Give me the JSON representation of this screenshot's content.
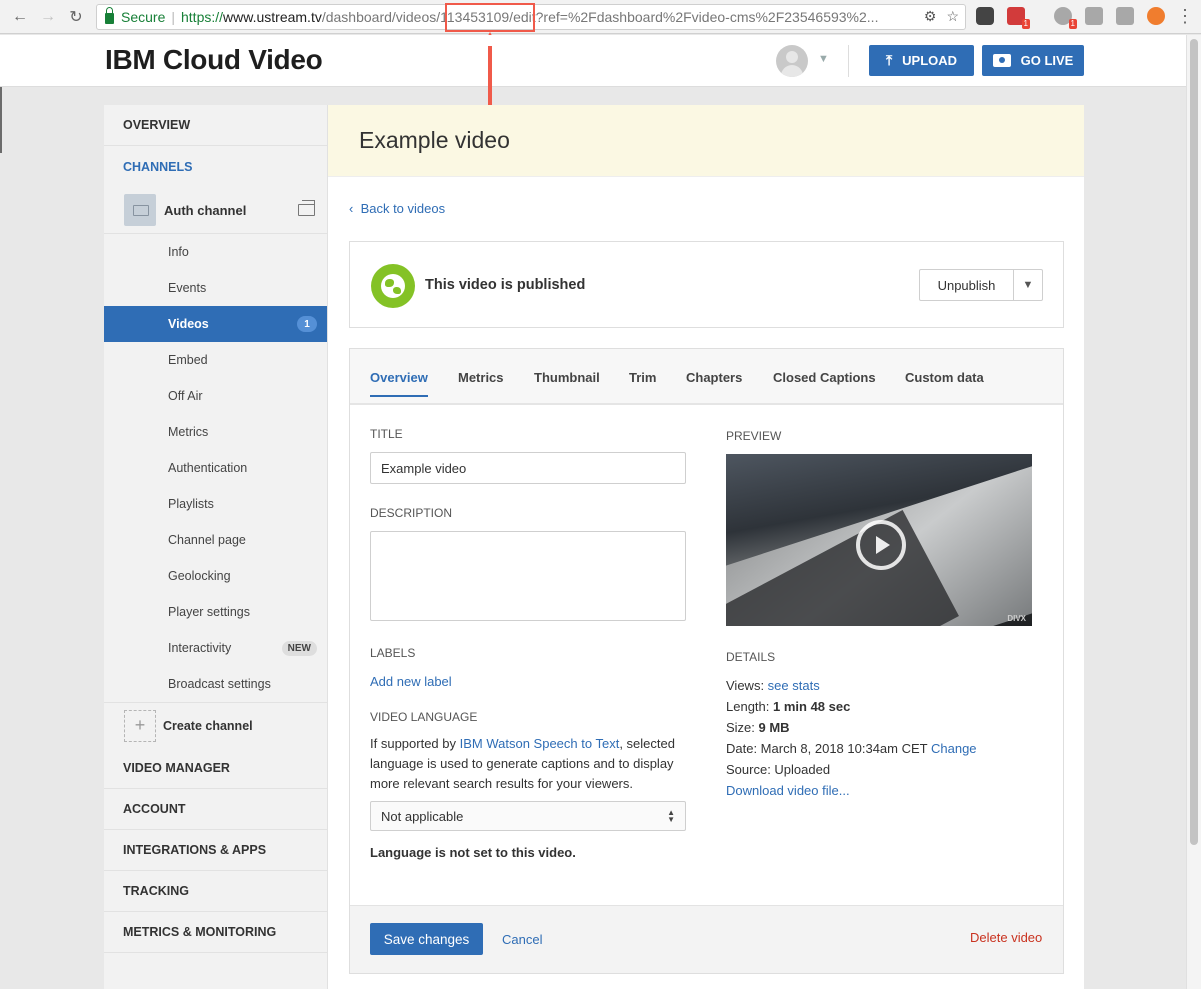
{
  "browser": {
    "secure_label": "Secure",
    "url_https": "https://",
    "url_host": "www.ustream.tv",
    "url_path": "/dashboard/videos/113453109/edit?ref=%2Fdashboard%2Fvideo-cms%2F23546593%2...",
    "badge_red": "1",
    "badge_green": "1"
  },
  "header": {
    "brand": "IBM Cloud Video",
    "upload_label": "UPLOAD",
    "golive_label": "GO LIVE"
  },
  "sidebar": {
    "overview": "OVERVIEW",
    "channels": "CHANNELS",
    "channel_name": "Auth channel",
    "sub_items": [
      {
        "label": "Info"
      },
      {
        "label": "Events"
      },
      {
        "label": "Videos",
        "count": "1"
      },
      {
        "label": "Embed"
      },
      {
        "label": "Off Air"
      },
      {
        "label": "Metrics"
      },
      {
        "label": "Authentication"
      },
      {
        "label": "Playlists"
      },
      {
        "label": "Channel page"
      },
      {
        "label": "Geolocking"
      },
      {
        "label": "Player settings"
      },
      {
        "label": "Interactivity",
        "badge": "NEW"
      },
      {
        "label": "Broadcast settings"
      }
    ],
    "create_channel": "Create channel",
    "bottom_items": [
      "VIDEO MANAGER",
      "ACCOUNT",
      "INTEGRATIONS & APPS",
      "TRACKING",
      "METRICS & MONITORING"
    ]
  },
  "main": {
    "title": "Example video",
    "back_link": "Back to videos",
    "published_text": "This video is published",
    "unpublish_label": "Unpublish",
    "tabs": [
      "Overview",
      "Metrics",
      "Thumbnail",
      "Trim",
      "Chapters",
      "Closed Captions",
      "Custom data"
    ],
    "form": {
      "title_label": "TITLE",
      "title_value": "Example video",
      "description_label": "DESCRIPTION",
      "description_value": "",
      "labels_label": "LABELS",
      "add_label_link": "Add new label",
      "language_label": "VIDEO LANGUAGE",
      "help_prefix": "If supported by ",
      "help_link": "IBM Watson Speech to Text",
      "help_suffix": ", selected language is used to generate captions and to display more relevant search results for your viewers.",
      "language_selected": "Not applicable",
      "language_note": "Language is not set to this video."
    },
    "preview_label": "PREVIEW",
    "preview_watermark": "DIVX",
    "details": {
      "label": "DETAILS",
      "views_key": "Views: ",
      "views_link": "see stats",
      "length_key": "Length: ",
      "length_value": "1 min 48 sec",
      "size_key": "Size: ",
      "size_value": "9 MB",
      "date_text": "Date: March 8, 2018 10:34am CET ",
      "date_change": "Change",
      "source_text": "Source: Uploaded",
      "download_link": "Download video file..."
    },
    "footer": {
      "save_label": "Save changes",
      "cancel_label": "Cancel",
      "delete_label": "Delete video"
    }
  }
}
